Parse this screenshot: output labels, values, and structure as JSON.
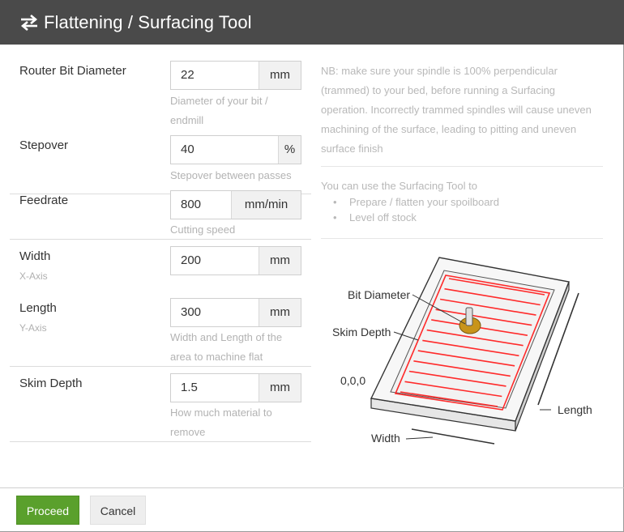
{
  "dialog": {
    "title": "Flattening / Surfacing Tool",
    "icon": "swap-arrows-icon"
  },
  "fields": {
    "router_bit_diameter": {
      "label": "Router Bit Diameter",
      "value": "22",
      "unit": "mm",
      "help": "Diameter of your bit / endmill"
    },
    "stepover": {
      "label": "Stepover",
      "value": "40",
      "unit": "%",
      "help": "Stepover between passes"
    },
    "feedrate": {
      "label": "Feedrate",
      "value": "800",
      "unit": "mm/min",
      "help": "Cutting speed"
    },
    "width": {
      "label": "Width",
      "sublabel": "X-Axis",
      "value": "200",
      "unit": "mm"
    },
    "length": {
      "label": "Length",
      "sublabel": "Y-Axis",
      "value": "300",
      "unit": "mm",
      "help": "Width and Length of the area to machine flat"
    },
    "skim_depth": {
      "label": "Skim Depth",
      "value": "1.5",
      "unit": "mm",
      "help": "How much material to remove"
    }
  },
  "info": {
    "note": "NB: make sure your spindle is 100% perpendicular (trammed) to your bed, before running a Surfacing operation. Incorrectly trammed spindles will cause uneven machining of the surface, leading to pitting and uneven surface finish",
    "intro": "You can use the Surfacing Tool to",
    "bullets": [
      "Prepare / flatten your spoilboard",
      "Level off stock"
    ]
  },
  "diagram": {
    "labels": {
      "bit_diameter": "Bit Diameter",
      "skim_depth": "Skim Depth",
      "origin": "0,0,0",
      "length": "Length",
      "width": "Width"
    },
    "colors": {
      "toolpath": "#ff2a2a",
      "bit_holder": "#c8941a"
    }
  },
  "footer": {
    "proceed_label": "Proceed",
    "cancel_label": "Cancel"
  },
  "colors": {
    "header_bg": "#4a4a4a",
    "proceed_bg": "#5aa02c"
  }
}
